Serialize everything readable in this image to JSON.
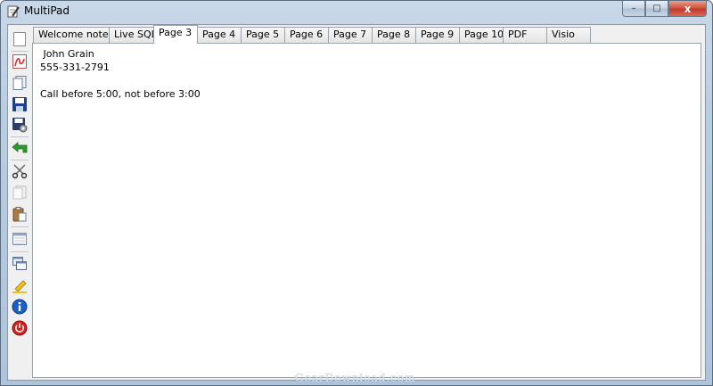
{
  "window": {
    "title": "MultiPad"
  },
  "caption_buttons": {
    "minimize": "–",
    "maximize": "□",
    "close": "x"
  },
  "toolbar": {
    "items": [
      {
        "name": "new-page-icon"
      },
      {
        "name": "pdf-icon"
      },
      {
        "name": "copy-document-icon"
      },
      {
        "name": "save-icon"
      },
      {
        "name": "save-settings-icon"
      },
      {
        "name": "undo-arrow-icon"
      },
      {
        "name": "cut-scissors-icon"
      },
      {
        "name": "copy-icon"
      },
      {
        "name": "paste-icon"
      },
      {
        "name": "calendar-icon"
      },
      {
        "name": "windows-icon"
      },
      {
        "name": "highlighter-icon"
      },
      {
        "name": "info-icon"
      },
      {
        "name": "power-icon"
      }
    ]
  },
  "tabs": [
    {
      "label": "Welcome note"
    },
    {
      "label": "Live SQL"
    },
    {
      "label": "Page 3"
    },
    {
      "label": "Page 4"
    },
    {
      "label": "Page 5"
    },
    {
      "label": "Page 6"
    },
    {
      "label": "Page 7"
    },
    {
      "label": "Page 8"
    },
    {
      "label": "Page 9"
    },
    {
      "label": "Page 10"
    },
    {
      "label": "PDF"
    },
    {
      "label": "Visio"
    }
  ],
  "active_tab": "Page 3",
  "editor": {
    "lines": [
      " John Grain",
      "555-331-2791",
      "",
      "Call before 5:00, not before 3:00"
    ]
  },
  "watermark": "GearDownload.com",
  "colors": {
    "pdf_red": "#d92b2b",
    "save_blue": "#1f3f8f",
    "undo_green": "#2e9a2e",
    "info_blue": "#1a5fc8",
    "power_red": "#d61f1f",
    "highlighter_yellow": "#f2c21b"
  }
}
